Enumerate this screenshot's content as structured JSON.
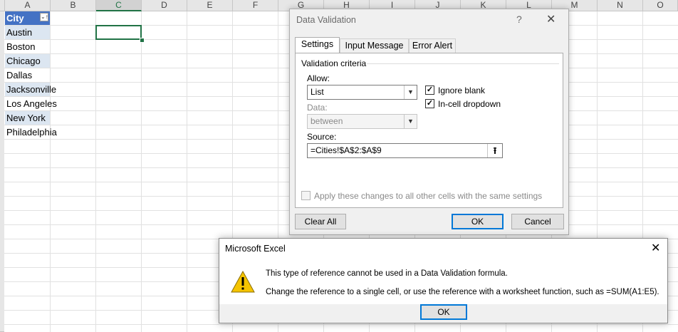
{
  "sheet": {
    "columns": [
      "A",
      "B",
      "C",
      "D",
      "E",
      "F",
      "G",
      "H",
      "I",
      "J",
      "K",
      "L",
      "M",
      "N",
      "O"
    ],
    "selected_column": "C",
    "table_header": "City",
    "filter_icon": "filter-dropdown-icon",
    "cities": [
      "Austin",
      "Boston",
      "Chicago",
      "Dallas",
      "Jacksonville",
      "Los Angeles",
      "New York",
      "Philadelphia"
    ]
  },
  "dv_dialog": {
    "title": "Data Validation",
    "help": "?",
    "close": "✕",
    "tabs": [
      "Settings",
      "Input Message",
      "Error Alert"
    ],
    "active_tab": "Settings",
    "group_label": "Validation criteria",
    "allow_label": "Allow:",
    "allow_value": "List",
    "data_label": "Data:",
    "data_value": "between",
    "ignore_blank_label": "Ignore blank",
    "ignore_blank_checked": true,
    "in_cell_label": "In-cell dropdown",
    "in_cell_checked": true,
    "source_label": "Source:",
    "source_value": "=Cities!$A$2:$A$9",
    "apply_label": "Apply these changes to all other cells with the same settings",
    "apply_checked": false,
    "clear_all": "Clear All",
    "ok": "OK",
    "cancel": "Cancel"
  },
  "alert": {
    "title": "Microsoft Excel",
    "close": "✕",
    "icon": "warning-icon",
    "line1": "This type of reference cannot be used in a Data Validation formula.",
    "line2": "Change the reference to a single cell, or use the reference with a worksheet function, such as =SUM(A1:E5).",
    "ok": "OK"
  },
  "colors": {
    "accent_green": "#217346",
    "table_header_blue": "#4472c4",
    "band_blue": "#dce6f1",
    "focus_blue": "#0078d7",
    "warning_yellow": "#f5c400"
  }
}
